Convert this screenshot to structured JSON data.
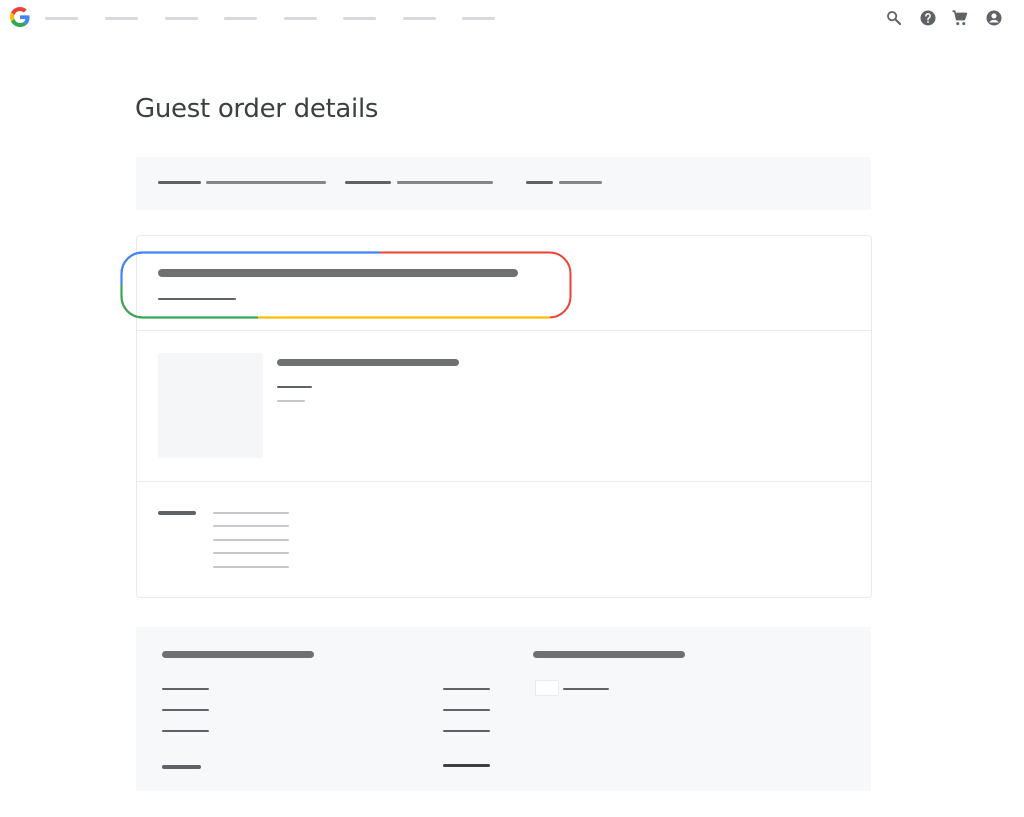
{
  "header": {
    "logo": "google-g-logo",
    "nav_items": [
      "",
      "",
      "",
      "",
      "",
      "",
      "",
      ""
    ],
    "icons": [
      "search-icon",
      "help-icon",
      "cart-icon",
      "account-icon"
    ]
  },
  "page": {
    "title": "Guest order details"
  },
  "colors": {
    "blue": "#4285f4",
    "red": "#ea4335",
    "yellow": "#fbbc04",
    "green": "#34a853",
    "text": "#3c4043",
    "panel": "#f7f8f9"
  }
}
